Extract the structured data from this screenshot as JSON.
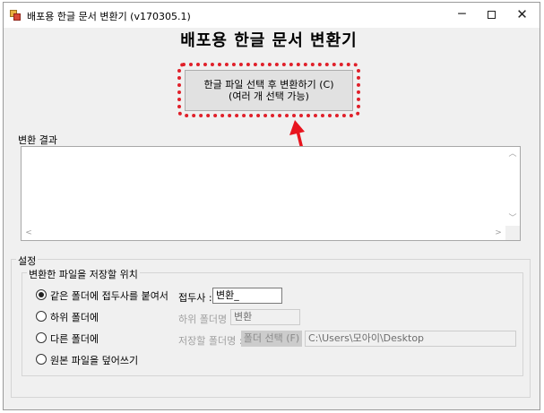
{
  "window": {
    "title": "배포용 한글 문서 변환기 (v170305.1)"
  },
  "controls": {
    "minimize": "─",
    "close": "✕"
  },
  "heading": "배포용 한글 문서 변환기",
  "convert_button": {
    "line1": "한글 파일 선택 후 변환하기 (C)",
    "line2": "(여러 개 선택 가능)"
  },
  "highlight_color": "#e0202a",
  "results": {
    "label": "변환 결과",
    "content": ""
  },
  "settings": {
    "label": "설정",
    "save_location": {
      "label": "변환한 파일을 저장할 위치",
      "options": [
        {
          "label": "같은 폴더에 접두사를 붙여서",
          "checked": true
        },
        {
          "label": "하위 폴더에",
          "checked": false
        },
        {
          "label": "다른 폴더에",
          "checked": false
        },
        {
          "label": "원본 파일을 덮어쓰기",
          "checked": false
        }
      ],
      "prefix_label": "접두사 :",
      "prefix_value": "변환_",
      "subfolder_label": "하위 폴더명 :",
      "subfolder_value": "변환",
      "folder_label": "저장할 폴더명 :",
      "folder_button": "폴더 선택 (F)",
      "folder_value": "C:\\Users\\모아이\\Desktop"
    }
  }
}
